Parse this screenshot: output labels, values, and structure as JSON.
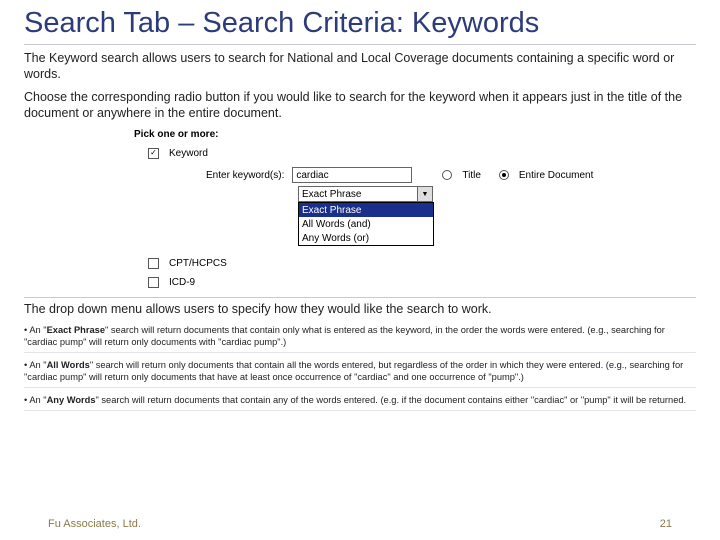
{
  "title": "Search Tab – Search Criteria: Keywords",
  "intro": {
    "p1": "The Keyword search allows users to search for National and Local Coverage documents containing a specific word or words.",
    "p2": "Choose the corresponding radio button if you would like to search for the keyword when it appears just in the title of the document or anywhere in the entire document."
  },
  "screenshot": {
    "header": "Pick one or more:",
    "keyword_check_label": "Keyword",
    "enter_label": "Enter keyword(s):",
    "input_value": "cardiac",
    "radios": {
      "title": "Title",
      "entire": "Entire Document"
    },
    "dropdown": {
      "selected": "Exact Phrase",
      "options": [
        "Exact Phrase",
        "All Words (and)",
        "Any Words (or)"
      ]
    },
    "other_checks": [
      "CPT/HCPCS",
      "ICD-9"
    ]
  },
  "after_dropdown": "The drop down menu allows users to specify how they would like the search to work.",
  "bullets": {
    "b1_pre": "An \"",
    "b1_bold": "Exact Phrase",
    "b1_post": "\" search will return documents that contain only what is entered as the keyword, in the order the words were entered. (e.g., searching for \"cardiac pump\" will return only documents with \"cardiac pump\".)",
    "b2_pre": "An \"",
    "b2_bold": "All Words",
    "b2_post": "\" search will return only documents that contain all the words entered, but regardless of the order in which they were entered. (e.g., searching for \"cardiac pump\" will return only documents that have at least once occurrence of \"cardiac\" and one occurrence of \"pump\".)",
    "b3_pre": "An \"",
    "b3_bold": "Any Words",
    "b3_post": "\" search will return documents that contain any of the words entered. (e.g. if the document contains either \"cardiac\" or \"pump\" it will be returned."
  },
  "footer": {
    "left": "Fu Associates, Ltd.",
    "right": "21"
  }
}
